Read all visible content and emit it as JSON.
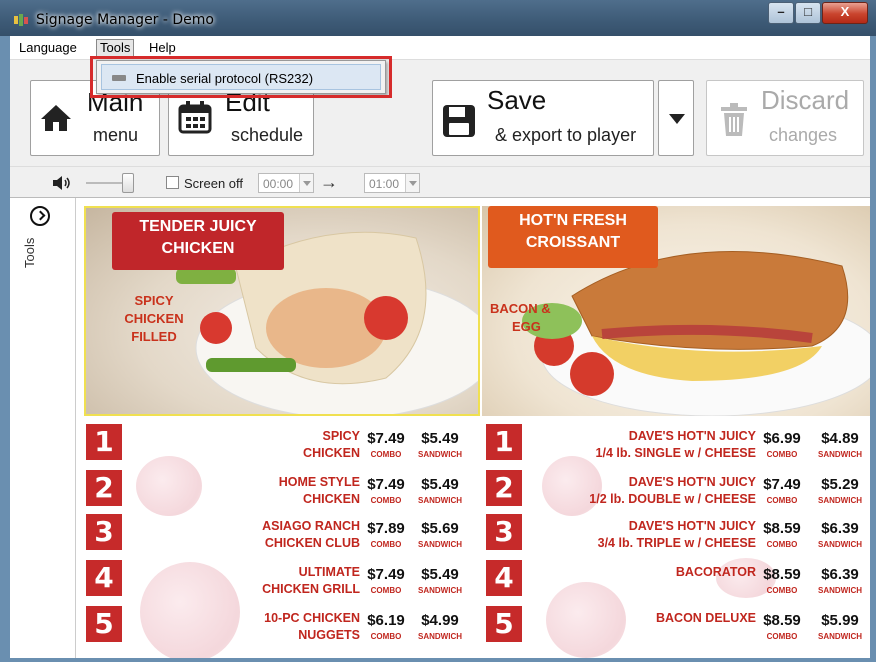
{
  "window": {
    "title": "Signage Manager - Demo",
    "min_glyph": "–",
    "max_glyph": "□",
    "close_glyph": "X"
  },
  "menubar": {
    "items": [
      "Language",
      "Tools",
      "Help"
    ],
    "active": "Tools"
  },
  "tools_menu": {
    "items": [
      "Enable serial protocol (RS232)"
    ]
  },
  "toolbar": {
    "main_big": "Main",
    "main_small": "menu",
    "edit_big": "Edit",
    "edit_small": "schedule",
    "save_big": "Save",
    "save_small": "& export to player",
    "discard_big": "Discard",
    "discard_small": "changes"
  },
  "subbar": {
    "screen_off_label": "Screen off",
    "from_time": "00:00",
    "to_time": "01:00",
    "arrow": "→",
    "volume_level": 0.9
  },
  "sidebar": {
    "label": "Tools"
  },
  "board": {
    "left_heading": [
      "TENDER JUICY",
      "CHICKEN"
    ],
    "left_sub": [
      "SPICY",
      "CHICKEN",
      "FILLED"
    ],
    "right_heading": [
      "HOT'N FRESH",
      "CROISSANT"
    ],
    "right_sub": [
      "BACON &",
      "EGG"
    ],
    "combo_label": "COMBO",
    "sandwich_label": "SANDWICH",
    "left_items": [
      {
        "n": "1",
        "l1": "SPICY",
        "l2": "CHICKEN",
        "combo": "$7.49",
        "sandwich": "$5.49"
      },
      {
        "n": "2",
        "l1": "HOME STYLE",
        "l2": "CHICKEN",
        "combo": "$7.49",
        "sandwich": "$5.49"
      },
      {
        "n": "3",
        "l1": "ASIAGO RANCH",
        "l2": "CHICKEN CLUB",
        "combo": "$7.89",
        "sandwich": "$5.69"
      },
      {
        "n": "4",
        "l1": "ULTIMATE",
        "l2": "CHICKEN GRILL",
        "combo": "$7.49",
        "sandwich": "$5.49"
      },
      {
        "n": "5",
        "l1": "10-PC CHICKEN",
        "l2": "NUGGETS",
        "combo": "$6.19",
        "sandwich": "$4.99"
      }
    ],
    "right_items": [
      {
        "n": "1",
        "l1": "DAVE'S HOT'N JUICY",
        "l2": "1/4 lb. SINGLE w / CHEESE",
        "combo": "$6.99",
        "sandwich": "$4.89"
      },
      {
        "n": "2",
        "l1": "DAVE'S HOT'N JUICY",
        "l2": "1/2 lb. DOUBLE w / CHEESE",
        "combo": "$7.49",
        "sandwich": "$5.29"
      },
      {
        "n": "3",
        "l1": "DAVE'S HOT'N JUICY",
        "l2": "3/4 lb. TRIPLE w / CHEESE",
        "combo": "$8.59",
        "sandwich": "$6.39"
      },
      {
        "n": "4",
        "l1": "",
        "l2": "BACORATOR",
        "combo": "$8.59",
        "sandwich": "$6.39"
      },
      {
        "n": "5",
        "l1": "",
        "l2": "BACON DELUXE",
        "combo": "$8.59",
        "sandwich": "$5.99"
      }
    ]
  },
  "colors": {
    "accent_red": "#c62a2a",
    "highlight_box": "#d62b2b",
    "tag_orange": "#e05a1e"
  },
  "icons": [
    "home-icon",
    "calendar-icon",
    "floppy-disk-icon",
    "chevron-down-icon",
    "trash-icon",
    "speaker-icon",
    "chevron-right-circle-icon"
  ]
}
